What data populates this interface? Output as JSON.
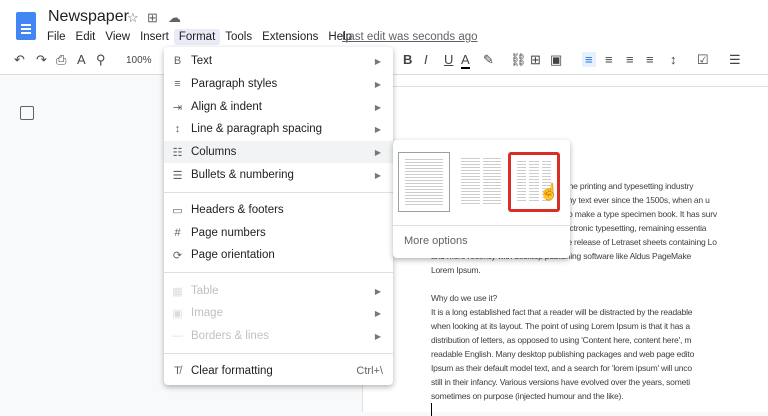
{
  "header": {
    "title": "Newspaper",
    "menu": [
      "File",
      "Edit",
      "View",
      "Insert",
      "Format",
      "Tools",
      "Extensions",
      "Help"
    ],
    "last_edit": "Last edit was seconds ago"
  },
  "toolbar": {
    "zoom": "100%"
  },
  "format_menu": {
    "items": [
      {
        "label": "Text",
        "icon": "B",
        "submenu": true
      },
      {
        "label": "Paragraph styles",
        "icon": "≡",
        "submenu": true
      },
      {
        "label": "Align & indent",
        "icon": "⇥",
        "submenu": true
      },
      {
        "label": "Line & paragraph spacing",
        "icon": "↕",
        "submenu": true
      },
      {
        "label": "Columns",
        "icon": "☷",
        "submenu": true
      },
      {
        "label": "Bullets & numbering",
        "icon": "☰",
        "submenu": true
      },
      {
        "label": "Headers & footers",
        "icon": "▭"
      },
      {
        "label": "Page numbers",
        "icon": "#"
      },
      {
        "label": "Page orientation",
        "icon": "⟳"
      },
      {
        "label": "Table",
        "icon": "▦",
        "submenu": true,
        "disabled": true
      },
      {
        "label": "Image",
        "icon": "▣",
        "submenu": true,
        "disabled": true
      },
      {
        "label": "Borders & lines",
        "icon": "—",
        "submenu": true,
        "disabled": true
      },
      {
        "label": "Clear formatting",
        "icon": "T̸",
        "shortcut": "Ctrl+\\"
      }
    ]
  },
  "columns_submenu": {
    "options": [
      "one-column",
      "two-column",
      "three-column"
    ],
    "selected": "three-column",
    "more": "More options",
    "highlight_color": "#d93025"
  },
  "document": {
    "lines": [
      "Lorem Ipsum is simply dummy text of the printing and typesetting industry",
      "has been the industry's standard dummy text ever since the 1500s, when an u",
      "took a galley of type and scrambled it to make a type specimen book. It has surv",
      "five centuries, but also the leap into electronic typesetting, remaining essentia",
      "It was popularised in the 1960s with the release of Letraset sheets containing Lo",
      "and more recently with desktop publishing software like Aldus PageMake",
      "Lorem Ipsum.",
      "",
      "Why do we use it?",
      "It is a long established fact that a reader will be distracted by the readable",
      "when looking at its layout. The point of using Lorem Ipsum is that it has a",
      "distribution of letters, as opposed to using 'Content here, content here', m",
      "readable English. Many desktop publishing packages and web page edito",
      "Ipsum as their default model text, and a search for 'lorem ipsum' will unco",
      "still in their infancy. Various versions have evolved over the years, someti",
      "sometimes on purpose (injected humour and the like)."
    ]
  }
}
